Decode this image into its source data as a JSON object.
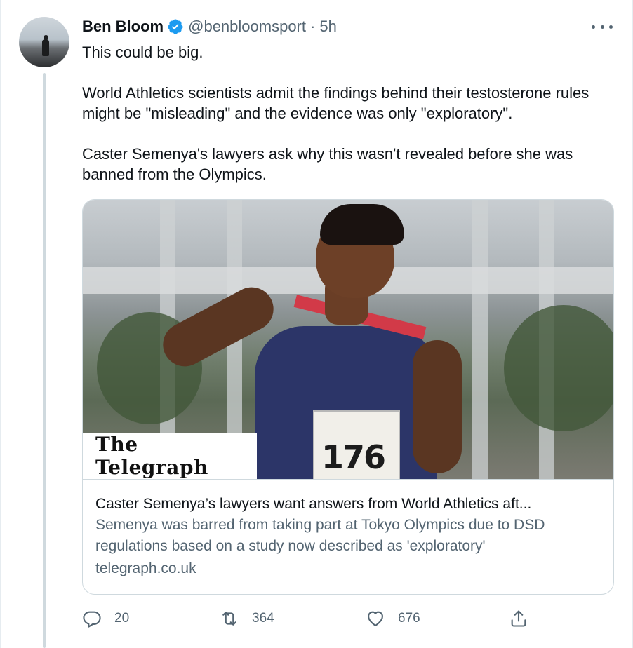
{
  "tweet": {
    "author_name": "Ben Bloom",
    "handle": "@benbloomsport",
    "separator": "·",
    "time": "5h",
    "text_lines": [
      "This could be big.",
      "World Athletics scientists admit the findings behind their testosterone rules might be \"misleading\" and the evidence was only \"exploratory\".",
      "Caster Semenya's lawyers ask why this wasn't revealed before she was banned from the Olympics."
    ]
  },
  "card": {
    "publisher_logo": "The Telegraph",
    "bib_number": "176",
    "headline": "Caster Semenya’s lawyers want answers from World Athletics aft...",
    "description": "Semenya was barred from taking part at Tokyo Olympics due to DSD regulations based on a study now described as 'exploratory'",
    "domain": "telegraph.co.uk"
  },
  "actions": {
    "replies": "20",
    "retweets": "364",
    "likes": "676"
  },
  "icons": {
    "verified": "verified-badge-icon",
    "more": "more-options-icon",
    "reply": "reply-icon",
    "retweet": "retweet-icon",
    "like": "heart-icon",
    "share": "share-icon"
  },
  "colors": {
    "text": "#0f1419",
    "secondary": "#536471",
    "verified_blue": "#1d9bf0",
    "border": "#cfd9de"
  }
}
